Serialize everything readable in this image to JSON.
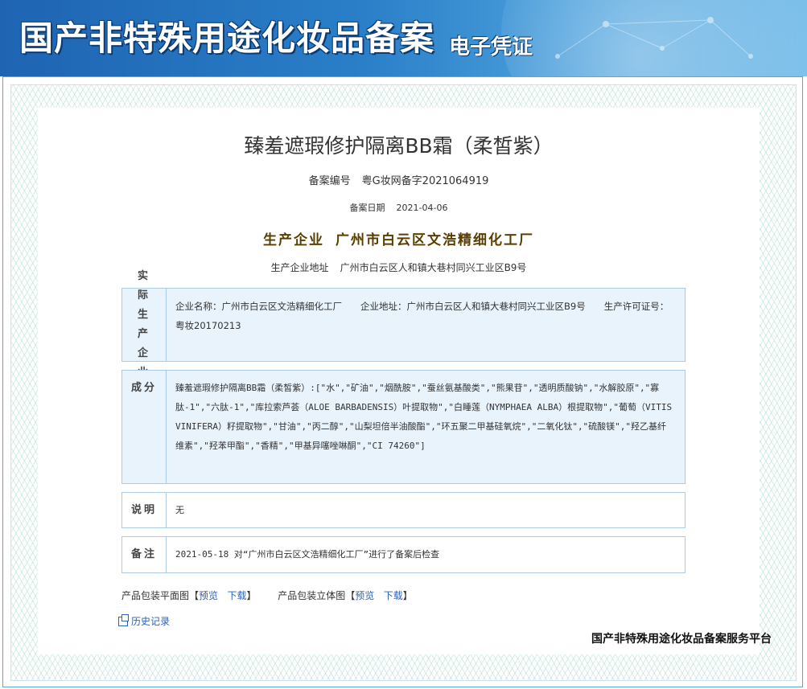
{
  "header": {
    "title": "国产非特殊用途化妆品备案",
    "subtitle": "电子凭证"
  },
  "certificate": {
    "product_name": "臻羞遮瑕修护隔离BB霜（柔皙紫）",
    "record_no_label": "备案编号",
    "record_no": "粤G妆网备字2021064919",
    "record_date_label": "备案日期",
    "record_date": "2021-04-06",
    "company_label": "生产企业",
    "company": "广州市白云区文浩精细化工厂",
    "address_label": "生产企业地址",
    "address": "广州市白云区人和镇大巷村同兴工业区B9号"
  },
  "sections": {
    "actual_producer": {
      "label": "实际生产企业",
      "text": "企业名称：广州市白云区文浩精细化工厂　　企业地址：广州市白云区人和镇大巷村同兴工业区B9号　　生产许可证号：粤妆20170213"
    },
    "ingredients": {
      "label": "成分",
      "text": "臻羞遮瑕修护隔离BB霜（柔皙紫）:[\"水\",\"矿油\",\"烟酰胺\",\"蚕丝氨基酸类\",\"熊果苷\",\"透明质酸钠\",\"水解胶原\",\"寡肽-1\",\"六肽-1\",\"库拉索芦荟（ALOE BARBADENSIS）叶提取物\",\"白睡莲（NYMPHAEA ALBA）根提取物\",\"葡萄（VITIS VINIFERA）籽提取物\",\"甘油\",\"丙二醇\",\"山梨坦倍半油酸酯\",\"环五聚二甲基硅氧烷\",\"二氧化钛\",\"硫酸镁\",\"羟乙基纤维素\",\"羟苯甲酯\",\"香精\",\"甲基异噻唑啉酮\",\"CI 74260\"]"
    },
    "notes": {
      "label": "说明",
      "text": "无"
    },
    "remarks": {
      "label": "备注",
      "text": "2021-05-18 对“广州市白云区文浩精细化工厂”进行了备案后检查"
    }
  },
  "packaging": {
    "flat_label": "产品包装平面图",
    "flat_preview": "预览",
    "flat_download": "下载",
    "solid_label": "产品包装立体图",
    "solid_preview": "预览",
    "solid_download": "下载",
    "bracket_open": "【",
    "bracket_close": "】"
  },
  "history_label": "历史记录",
  "platform": "国产非特殊用途化妆品备案服务平台",
  "colors": {
    "banner": "#1e64b2",
    "link": "#2a63b5",
    "section_bg": "#e8f3fb",
    "company_text": "#5a3e00"
  }
}
